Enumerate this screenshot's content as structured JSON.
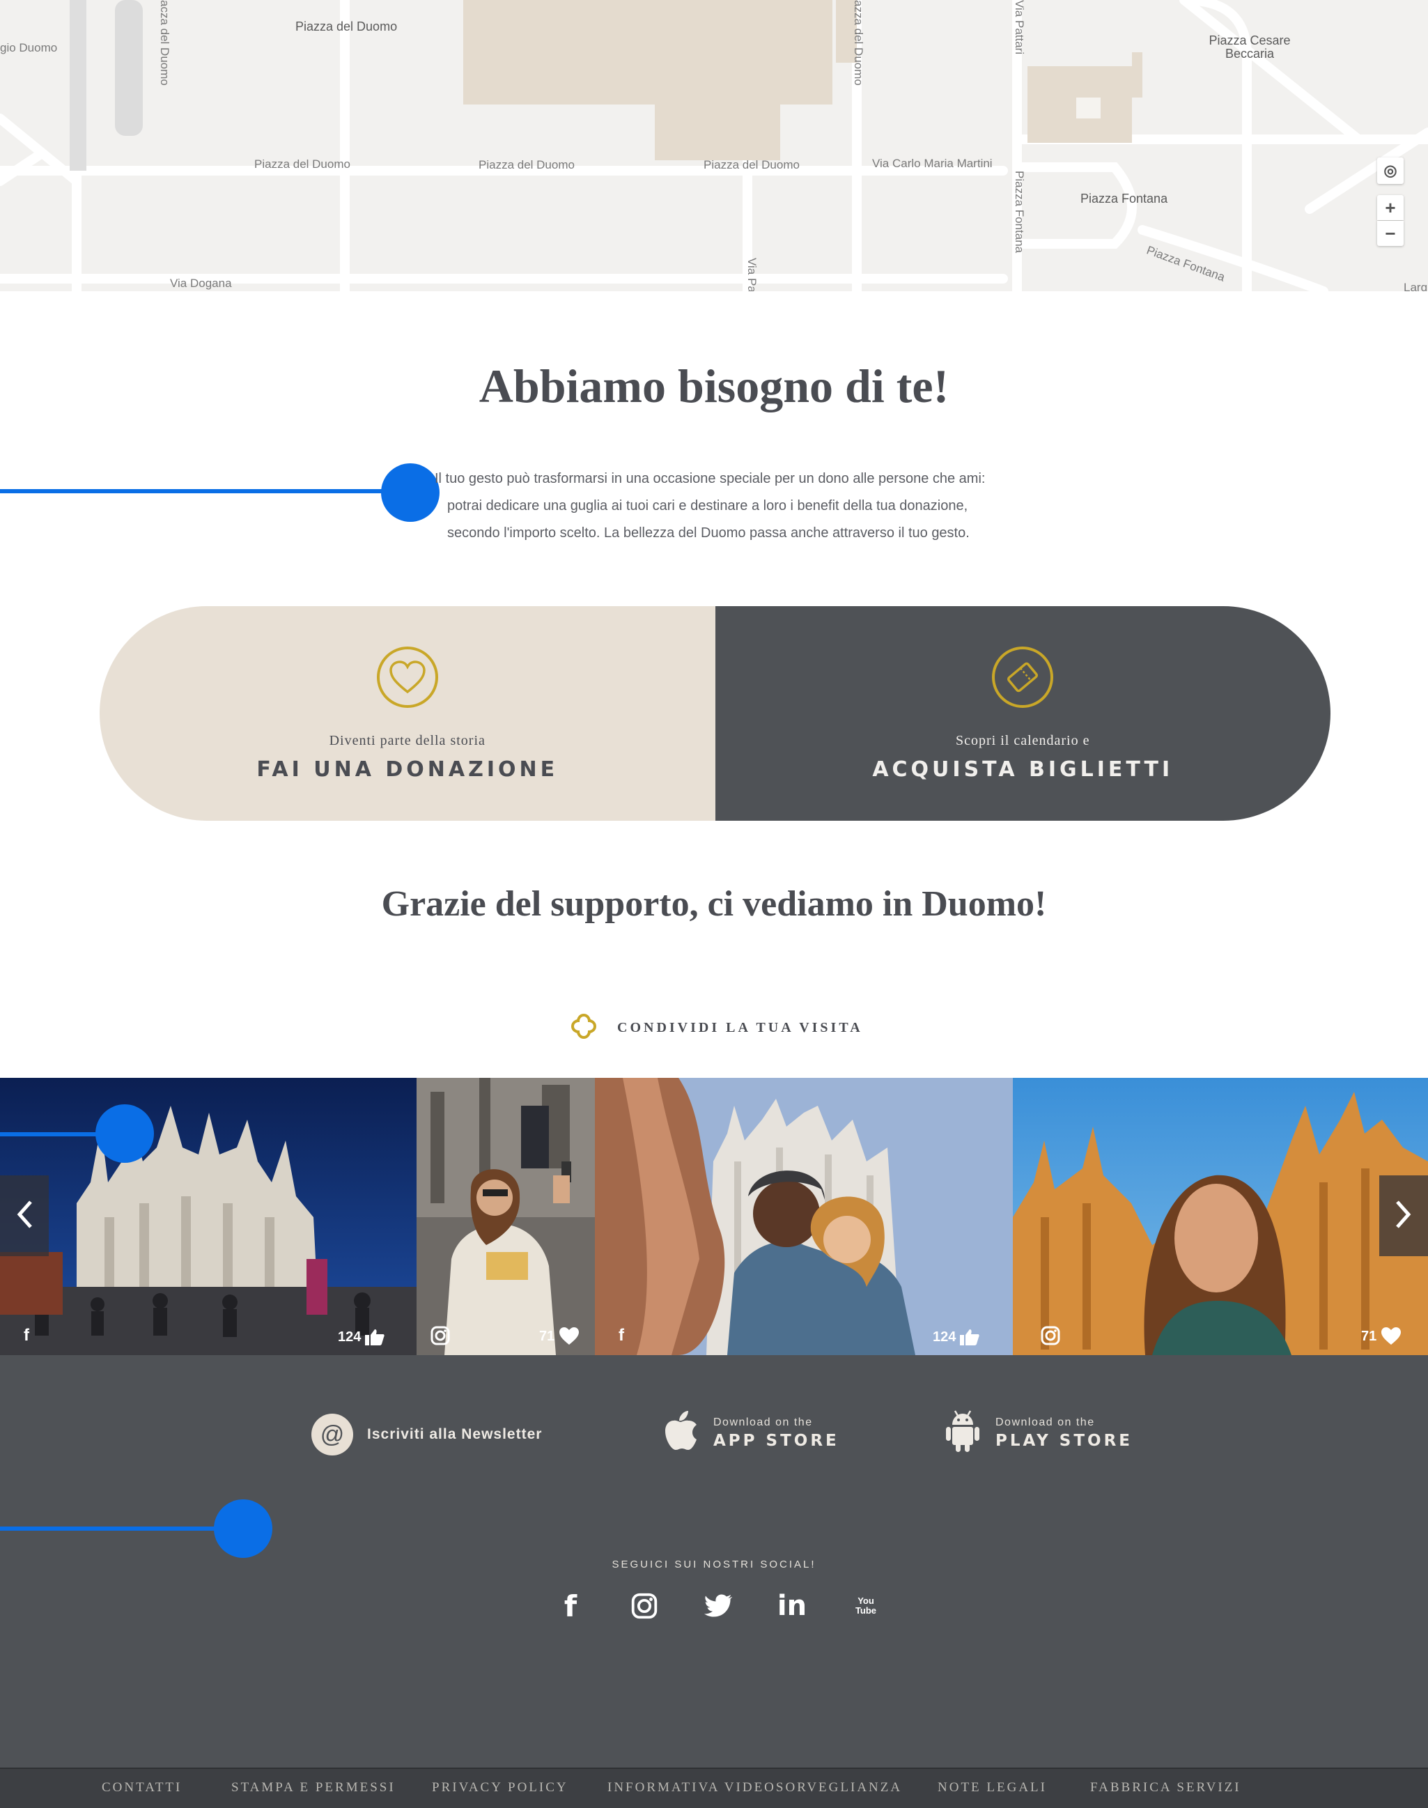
{
  "map": {
    "labels": {
      "piazza_duomo_top": "Piazza del Duomo",
      "giodu": "gio Duomo",
      "piazza_cesare": "Piazza Cesare Beccaria",
      "piazza_fontana": "Piazza Fontana",
      "street_pd1": "Piazza del Duomo",
      "street_pd2": "Piazza del Duomo",
      "street_pd3": "Piazza del Duomo",
      "carlo_maria": "Via Carlo Maria Martini",
      "via_dogana": "Via Dogana",
      "v_pataria": "Via Pattari",
      "v_pdd": "azza del Duomo",
      "v_pdd2": "acza del Duomo",
      "piazza_fontana_rot": "Piazza Fontana",
      "piazza_fontana_rot2": "Piazza Fontana",
      "via_pa": "Via Pa",
      "larg": "Larg"
    },
    "controls": {
      "locate": "◎",
      "zoom_in": "+",
      "zoom_out": "−"
    }
  },
  "section": {
    "title": "Abbiamo bisogno di te!",
    "intro": [
      "Il tuo gesto può trasformarsi in una occasione speciale per un dono alle persone che ami:",
      "potrai dedicare una guglia ai tuoi cari e destinare a loro i benefit della tua donazione,",
      "secondo l'importo scelto. La bellezza del Duomo passa anche attraverso il tuo gesto."
    ]
  },
  "cta": {
    "left": {
      "sub": "Diventi parte della storia",
      "main": "FAI UNA DONAZIONE",
      "icon": "heart-icon"
    },
    "right": {
      "sub": "Scopri il calendario e",
      "main": "ACQUISTA BIGLIETTI",
      "icon": "ticket-icon"
    }
  },
  "thanks": "Grazie del supporto, ci vediamo in Duomo!",
  "share": {
    "label": "CONDIVIDI LA TUA VISITA",
    "icon": "quatrefoil-icon"
  },
  "gallery": {
    "photos": [
      {
        "source": "f",
        "source_icon": "facebook-icon",
        "count": "124",
        "count_icon": "thumbs-up-icon"
      },
      {
        "source": "instagram",
        "source_icon": "instagram-icon",
        "count": "71",
        "count_icon": "heart-icon"
      },
      {
        "source": "f",
        "source_icon": "facebook-icon",
        "count": "124",
        "count_icon": "thumbs-up-icon"
      },
      {
        "source": "instagram",
        "source_icon": "instagram-icon",
        "count": "71",
        "count_icon": "heart-icon"
      }
    ],
    "prev_icon": "chevron-left-icon",
    "next_icon": "chevron-right-icon"
  },
  "footer": {
    "newsletter": {
      "icon": "at-icon",
      "label": "Iscriviti alla Newsletter"
    },
    "app_store": {
      "icon": "apple-icon",
      "small": "Download on the",
      "big": "APP STORE"
    },
    "play_store": {
      "icon": "android-icon",
      "small": "Download on the",
      "big": "PLAY STORE"
    },
    "social_title": "SEGUICI SUI NOSTRI SOCIAL!",
    "social": [
      {
        "name": "facebook-icon",
        "glyph": "f"
      },
      {
        "name": "instagram-icon",
        "glyph": ""
      },
      {
        "name": "twitter-icon",
        "glyph": ""
      },
      {
        "name": "linkedin-icon",
        "glyph": "in"
      },
      {
        "name": "youtube-icon",
        "glyph": "You Tube"
      }
    ]
  },
  "bottom_links": [
    "CONTATTI",
    "STAMPA E PERMESSI",
    "PRIVACY POLICY",
    "INFORMATIVA VIDEOSORVEGLIANZA",
    "NOTE LEGALI",
    "FABBRICA SERVIZI"
  ],
  "colors": {
    "accent": "#0a6ee6",
    "gold": "#c9a728",
    "beige": "#e8e0d5",
    "dark": "#4f5256"
  }
}
